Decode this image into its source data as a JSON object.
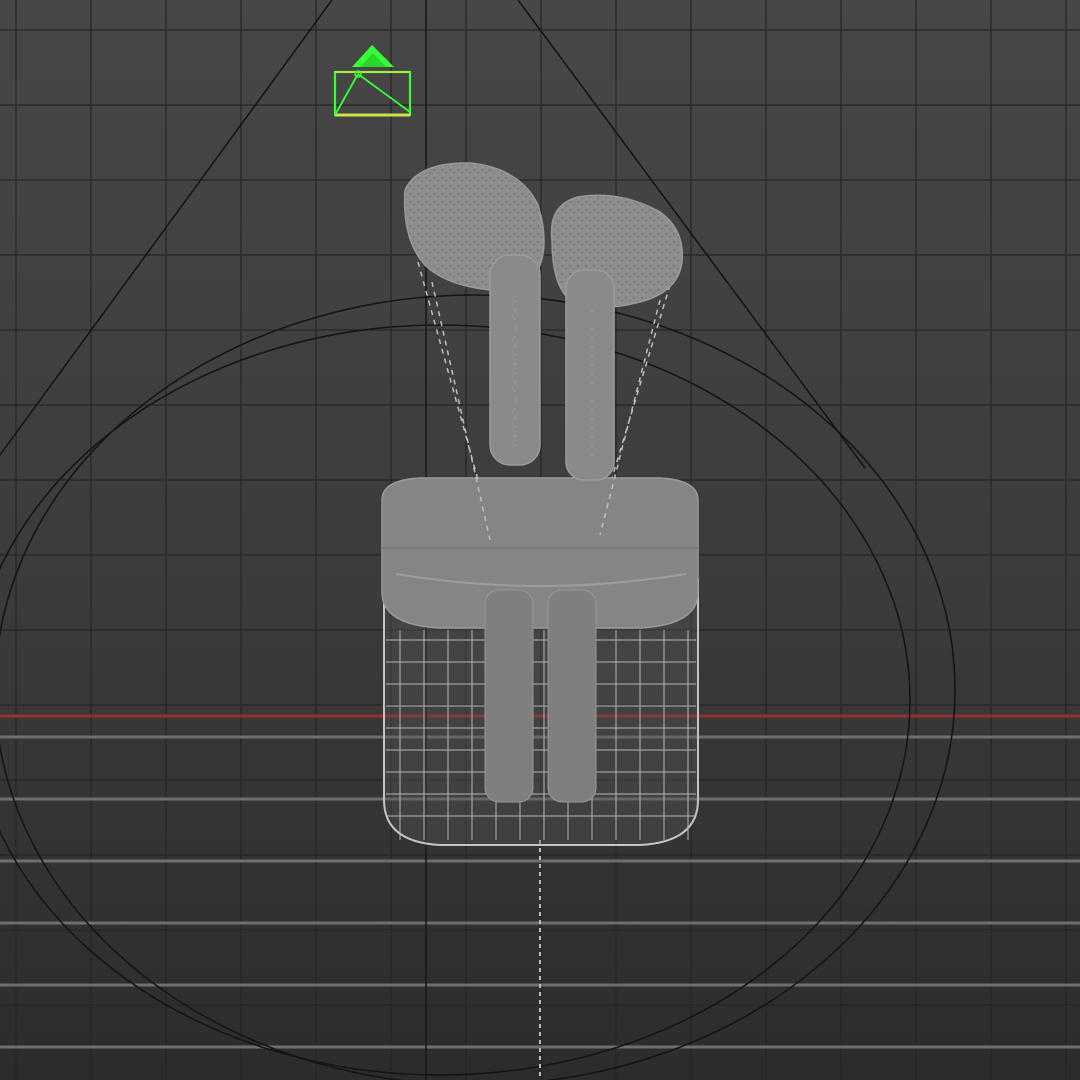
{
  "viewport": {
    "view": "front",
    "shading": "wireframe-on-shaded",
    "grid_visible": true,
    "colors": {
      "background_top": "#474747",
      "background_bottom": "#2c2c2c",
      "grid": "#262626",
      "horizon": "#9a2d2d",
      "ground_lines": "#6f6f6f",
      "mesh": "#8a8a8a",
      "wire": "#bdbdbd",
      "camera": "#36ff36",
      "camera_frame": "#cde24a",
      "light_cone": "#1a1a1a"
    }
  },
  "scene": {
    "objects": [
      {
        "name": "airpod-left",
        "icon": "earbud-mesh-icon"
      },
      {
        "name": "airpod-right",
        "icon": "earbud-mesh-icon"
      },
      {
        "name": "charging-case",
        "icon": "case-wireframe-icon"
      },
      {
        "name": "camera",
        "icon": "camera-gizmo-icon"
      },
      {
        "name": "spot-light",
        "icon": "light-cone-icon"
      }
    ]
  }
}
